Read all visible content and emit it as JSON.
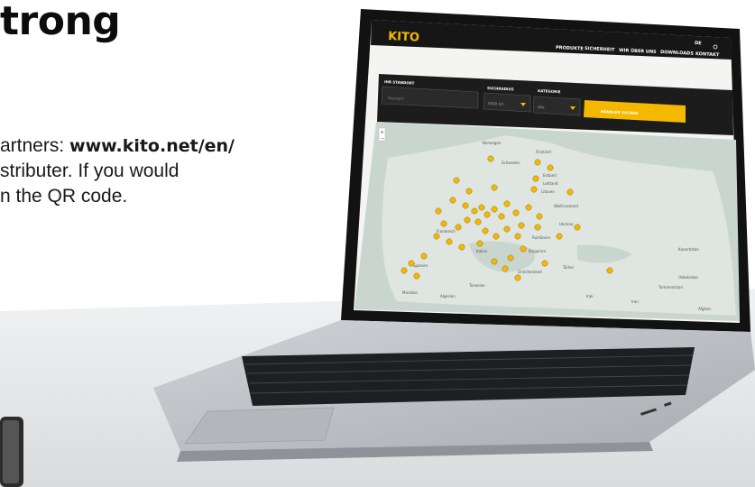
{
  "heading": "trong",
  "body_text": {
    "line1_prefix": "artners: ",
    "line1_url": "www.kito.net/en/",
    "line2": "stributer. If you would",
    "line3": "n the QR code."
  },
  "laptop_screen": {
    "logo": "KITO",
    "nav": [
      "PRODUKTE",
      "SICHERHEIT",
      "WIR ÜBER UNS",
      "DOWNLOADS",
      "KONTAKT"
    ],
    "lang_switch": "DE",
    "search": {
      "location_label": "IHR STANDORT",
      "location_placeholder": "Standort",
      "radius_label": "SUCHRADIUS",
      "radius_value": "5000 km",
      "category_label": "KATEGORIE",
      "category_value": "Alle",
      "submit_label": "HÄNDLER SUCHEN"
    },
    "map": {
      "labels": [
        "Finnland",
        "Norwegen",
        "Schweden",
        "Estland",
        "Lettland",
        "Litauen",
        "Weißrussland",
        "Ukraine",
        "Rumänien",
        "Bulgarien",
        "Türkei",
        "Italien",
        "Spanien",
        "Frankreich",
        "Griechenland",
        "Kasachstan",
        "Usbekistan",
        "Turkmenistan",
        "Irak",
        "Iran",
        "Afghan",
        "Marokko",
        "Tunesien",
        "Algerien"
      ],
      "marker_count": 48
    }
  },
  "colors": {
    "accent": "#f5b800",
    "screen_header": "#161616",
    "map_land": "#dfe5e0",
    "map_water": "#c9d6d0",
    "laptop_body": "#b9bcc1",
    "laptop_deck": "#c7cace"
  }
}
